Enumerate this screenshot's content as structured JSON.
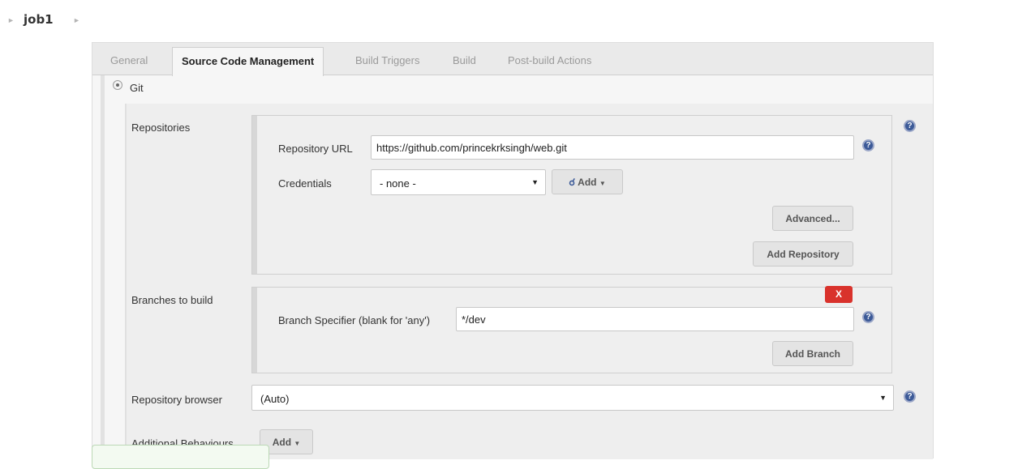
{
  "breadcrumb": {
    "job_name": "job1"
  },
  "tabs": [
    "General",
    "Source Code Management",
    "Build Triggers",
    "Build",
    "Post-build Actions"
  ],
  "scm": {
    "selected_option": "Git",
    "repositories": {
      "label": "Repositories",
      "url_label": "Repository URL",
      "url_value": "https://github.com/princekrksingh/web.git",
      "credentials_label": "Credentials",
      "credentials_value": "- none -",
      "add_label": "Add",
      "advanced_label": "Advanced...",
      "add_repository_label": "Add Repository"
    },
    "branches": {
      "label": "Branches to build",
      "delete_label": "X",
      "specifier_label": "Branch Specifier (blank for 'any')",
      "specifier_value": "*/dev",
      "add_branch_label": "Add Branch"
    },
    "repo_browser": {
      "label": "Repository browser",
      "value": "(Auto)"
    },
    "additional_behaviours": {
      "label": "Additional Behaviours",
      "add_label": "Add"
    }
  },
  "colors": {
    "help_icon": "#3c5a98",
    "delete_button": "#d9322c"
  }
}
